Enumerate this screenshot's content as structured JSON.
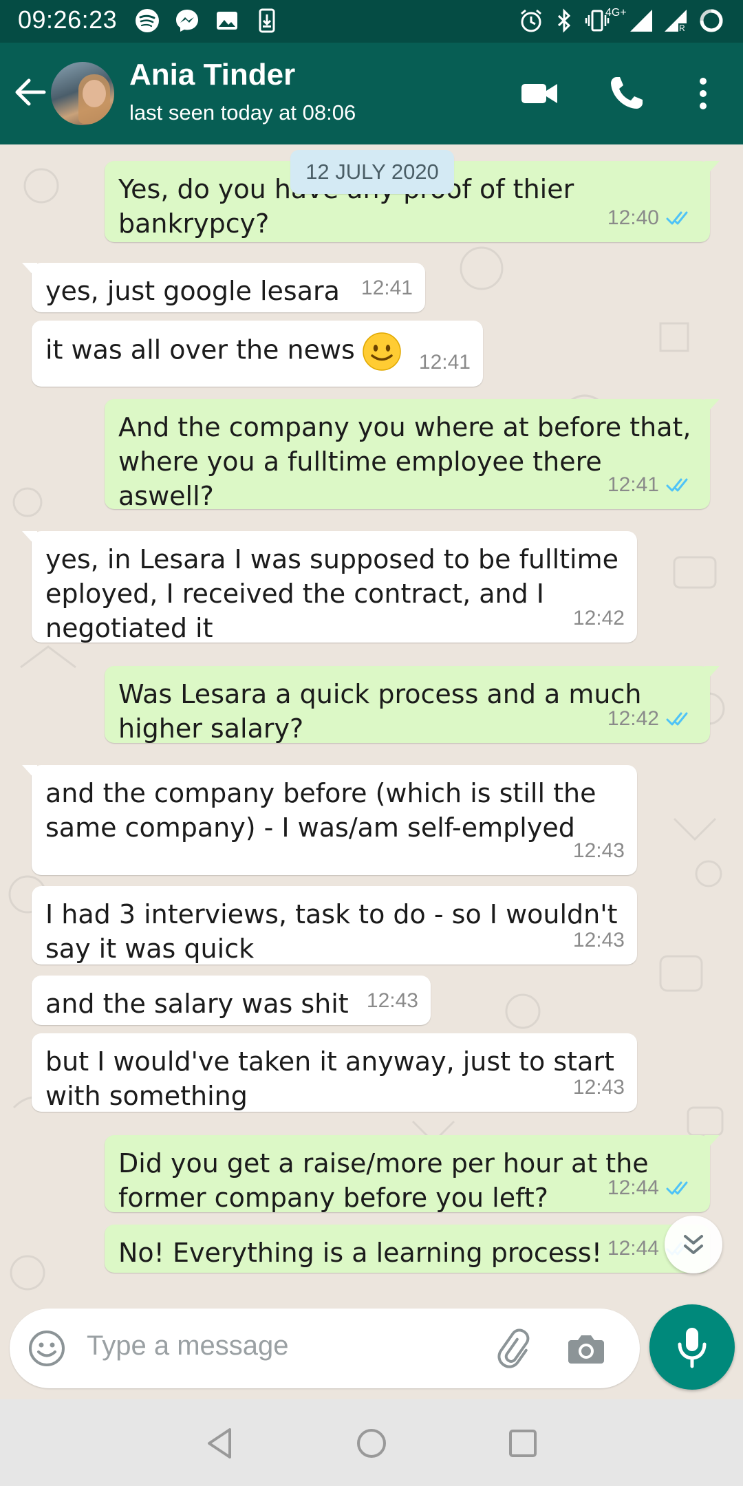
{
  "status_bar": {
    "time": "09:26:23",
    "network_label": "4G+",
    "icons": [
      "spotify-icon",
      "messenger-icon",
      "gallery-icon",
      "download-icon",
      "alarm-icon",
      "bluetooth-icon",
      "vibrate-icon",
      "signal-icon",
      "signal-roaming-icon",
      "battery-icon"
    ]
  },
  "header": {
    "contact_name": "Ania Tinder",
    "last_seen": "last seen today at 08:06",
    "icons": [
      "back-arrow-icon",
      "video-call-icon",
      "phone-call-icon",
      "more-options-icon"
    ]
  },
  "date_chip": "12 JULY 2020",
  "messages": [
    {
      "direction": "out",
      "text": "Yes, do you have any proof of thier\nbankrypcy?",
      "time": "12:40",
      "status": "read"
    },
    {
      "direction": "in",
      "text": "yes, just google lesara",
      "time": "12:41"
    },
    {
      "direction": "in",
      "text": "it was all over the news",
      "emoji": "slightly-smiling-face",
      "time": "12:41"
    },
    {
      "direction": "out",
      "text": "And the company you where at before that,\nwhere you a fulltime employee there aswell?",
      "time": "12:41",
      "status": "read"
    },
    {
      "direction": "in",
      "text": "yes, in Lesara I was supposed to be fulltime\neployed, I received the contract, and I\nnegotiated it",
      "time": "12:42"
    },
    {
      "direction": "out",
      "text": "Was Lesara a quick process and a much\nhigher salary?",
      "time": "12:42",
      "status": "read"
    },
    {
      "direction": "in",
      "text": "and the company before (which is still the\nsame company) - I was/am self-emplyed",
      "time": "12:43"
    },
    {
      "direction": "in",
      "text": "I had 3 interviews, task to do - so I wouldn't\nsay it was quick",
      "time": "12:43"
    },
    {
      "direction": "in",
      "text": "and the salary was shit",
      "time": "12:43"
    },
    {
      "direction": "in",
      "text": "but I would've taken it anyway, just to start\nwith something",
      "time": "12:43"
    },
    {
      "direction": "out",
      "text": "Did you get a raise/more per hour at the\nformer company before you left?",
      "time": "12:44",
      "status": "read"
    },
    {
      "direction": "out",
      "text": "No! Everything is a learning process!",
      "time": "12:44",
      "status": "read"
    }
  ],
  "composer": {
    "placeholder": "Type a message",
    "icons": [
      "emoji-icon",
      "attach-icon",
      "camera-icon",
      "mic-icon"
    ]
  },
  "colors": {
    "header": "#075e54",
    "status_bar": "#054c44",
    "outgoing_bubble": "#dcf8c6",
    "incoming_bubble": "#ffffff",
    "chat_background": "#ece5dd",
    "read_ticks": "#4fc3f7",
    "mic_button": "#00897b"
  }
}
